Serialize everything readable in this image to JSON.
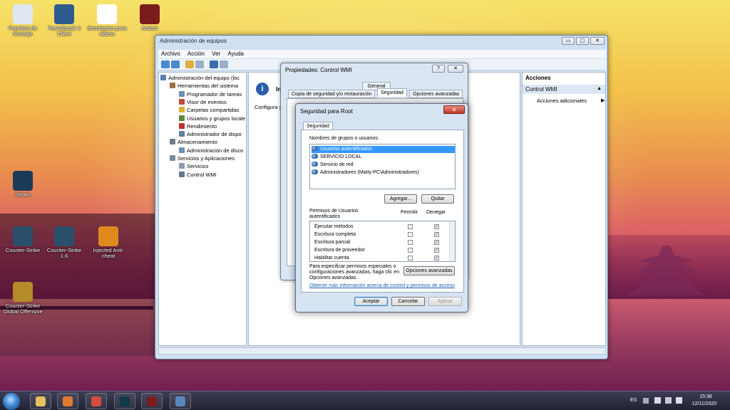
{
  "desktop": {
    "icons": [
      {
        "label": "Papelera de reciclaje",
        "icon": "recycle-bin-icon",
        "color": "#dfe8f2"
      },
      {
        "label": "TeamSpeak 3 Client",
        "icon": "teamspeak-icon",
        "color": "#2f5c8f"
      },
      {
        "label": "descripcion para videos",
        "icon": "text-document-icon",
        "color": "#ffffff"
      },
      {
        "label": "Action!",
        "icon": "action-recorder-icon",
        "color": "#7a1c1c"
      },
      {
        "label": "Steam",
        "icon": "steam-icon",
        "color": "#1b3a5a"
      },
      {
        "label": "Counter-Strike",
        "icon": "counter-strike-icon",
        "color": "#2a4f6b"
      },
      {
        "label": "Counter-Strike 1.6",
        "icon": "counter-strike-icon",
        "color": "#2a4f6b"
      },
      {
        "label": "Injected Anti-cheat",
        "icon": "injected-anticheat-icon",
        "color": "#e08a1e"
      },
      {
        "label": "Counter-Strike Global Offensive",
        "icon": "csgo-icon",
        "color": "#b58a2a"
      }
    ]
  },
  "main_window": {
    "title": "Administración de equipos",
    "controls": [
      "▭",
      "▢",
      "✕"
    ],
    "menu": [
      "Archivo",
      "Acción",
      "Ver",
      "Ayuda"
    ],
    "tree": [
      {
        "label": "Administración del equipo (loc",
        "indent": 0,
        "icon_color": "#5a7fb0"
      },
      {
        "label": "Herramientas del sistema",
        "indent": 1,
        "icon_color": "#a07040"
      },
      {
        "label": "Programador de tareas",
        "indent": 2,
        "icon_color": "#6b8fb8"
      },
      {
        "label": "Visor de eventos",
        "indent": 2,
        "icon_color": "#c04a3a"
      },
      {
        "label": "Carpetas compartidas",
        "indent": 2,
        "icon_color": "#e0b030"
      },
      {
        "label": "Usuarios y grupos locale",
        "indent": 2,
        "icon_color": "#5a8a40"
      },
      {
        "label": "Rendimiento",
        "indent": 2,
        "icon_color": "#c03030"
      },
      {
        "label": "Administrador de dispo",
        "indent": 2,
        "icon_color": "#6080a0"
      },
      {
        "label": "Almacenamiento",
        "indent": 1,
        "icon_color": "#707a88"
      },
      {
        "label": "Administración de disco",
        "indent": 2,
        "icon_color": "#6b8fb8"
      },
      {
        "label": "Servicios y Aplicaciones",
        "indent": 1,
        "icon_color": "#7a8a9a"
      },
      {
        "label": "Servicios",
        "indent": 2,
        "icon_color": "#8a9aaa"
      },
      {
        "label": "Control WMI",
        "indent": 2,
        "icon_color": "#607890"
      }
    ],
    "center_partial": "Configura y",
    "center_info_partial": "In",
    "actions": {
      "header": "Acciones",
      "selected": "Control WMI",
      "more": "Acciones adicionales"
    }
  },
  "props_dialog": {
    "title": "Propiedades: Control WMI",
    "help": "?",
    "close": "✕",
    "tabs_row1": [
      "General"
    ],
    "tabs_row2": [
      "Copia de seguridad y/o restauración",
      "Seguridad",
      "Opciones avanzadas"
    ]
  },
  "security_dialog": {
    "title": "Seguridad para Root",
    "close": "✕",
    "tab": "Seguridad",
    "groups_label": "Nombres de grupos o usuarios:",
    "users": [
      "Usuarios autentificados",
      "SERVICIO LOCAL",
      "Servicio de red",
      "Administradores (Matty-PC\\Administradores)"
    ],
    "add_label": "Agregar...",
    "remove_label": "Quitar",
    "perms_label": "Permisos de Usuarios autentificados",
    "allow_label": "Permitir",
    "deny_label": "Denegar",
    "permissions": [
      {
        "name": "Ejecutar métodos",
        "allow": false,
        "deny": true
      },
      {
        "name": "Escritura completa",
        "allow": false,
        "deny": true
      },
      {
        "name": "Escritura parcial",
        "allow": false,
        "deny": true
      },
      {
        "name": "Escritura de proveedor",
        "allow": false,
        "deny": true
      },
      {
        "name": "Habilitar cuenta",
        "allow": false,
        "deny": true
      }
    ],
    "advanced_text": "Para especificar permisos especiales o configuraciones avanzadas, haga clic en Opciones avanzadas.",
    "advanced_button": "Opciones avanzadas",
    "link": "Obtener más información acerca de control y permisos de acceso",
    "ok": "Aceptar",
    "cancel": "Cancelar",
    "apply": "Aplicar"
  },
  "taskbar": {
    "apps": [
      {
        "icon": "explorer-icon",
        "color": "#e8c060"
      },
      {
        "icon": "media-player-icon",
        "color": "#e07a30"
      },
      {
        "icon": "chrome-icon",
        "color": "#d44c3c"
      },
      {
        "icon": "vegas-icon",
        "color": "#0e3a4a"
      },
      {
        "icon": "action-recorder-icon",
        "color": "#7a1c1c"
      },
      {
        "icon": "computer-management-icon",
        "color": "#5a86c0"
      }
    ],
    "language": "ES",
    "time": "15:38",
    "date": "12/11/2020"
  }
}
